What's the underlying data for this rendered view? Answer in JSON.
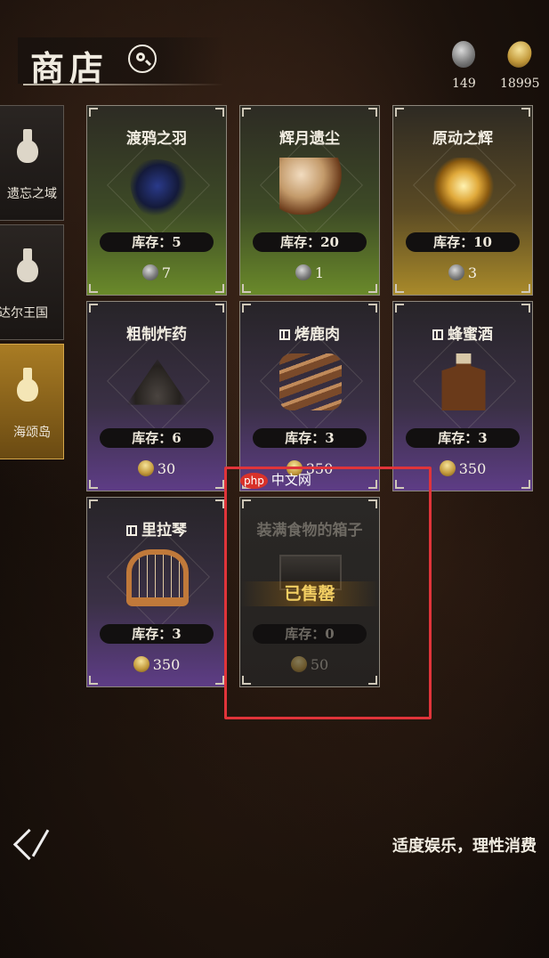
{
  "header": {
    "title": "商店"
  },
  "currency": [
    {
      "icon": "stone-coin-icon",
      "amount": "149"
    },
    {
      "icon": "gold-coin-icon",
      "amount": "18995"
    }
  ],
  "sidebar": {
    "tabs": [
      {
        "label": "遗忘之域",
        "icon": "potion-bottle-icon",
        "active": false
      },
      {
        "label": "达尔王国",
        "icon": "potion-bottle-icon",
        "active": false
      },
      {
        "label": "海颂岛",
        "icon": "potion-bottle-icon",
        "active": true
      }
    ]
  },
  "items": [
    {
      "name": "渡鸦之羽",
      "stock": "库存：5",
      "price": "7",
      "currency": "stone",
      "tier": "green",
      "gift": false
    },
    {
      "name": "辉月遗尘",
      "stock": "库存：20",
      "price": "1",
      "currency": "stone",
      "tier": "green",
      "gift": false
    },
    {
      "name": "原动之辉",
      "stock": "库存：10",
      "price": "3",
      "currency": "stone",
      "tier": "gold",
      "gift": false
    },
    {
      "name": "粗制炸药",
      "stock": "库存：6",
      "price": "30",
      "currency": "gold",
      "tier": "purple",
      "gift": false
    },
    {
      "name": "烤鹿肉",
      "stock": "库存：3",
      "price": "350",
      "currency": "gold",
      "tier": "purple",
      "gift": true
    },
    {
      "name": "蜂蜜酒",
      "stock": "库存：3",
      "price": "350",
      "currency": "gold",
      "tier": "purple",
      "gift": true
    },
    {
      "name": "里拉琴",
      "stock": "库存：3",
      "price": "350",
      "currency": "gold",
      "tier": "purple",
      "gift": true
    },
    {
      "name": "装满食物的箱子",
      "stock": "库存：0",
      "price": "50",
      "currency": "gold",
      "tier": "dark",
      "gift": false,
      "sold_label": "已售罄"
    }
  ],
  "watermark": {
    "logo": "php",
    "text": "中文网"
  },
  "footer": {
    "notice": "适度娱乐，理性消费"
  },
  "colors": {
    "highlight": "#e0343a",
    "sold_text": "#f3cf63",
    "active_tab": "#a97c24"
  }
}
